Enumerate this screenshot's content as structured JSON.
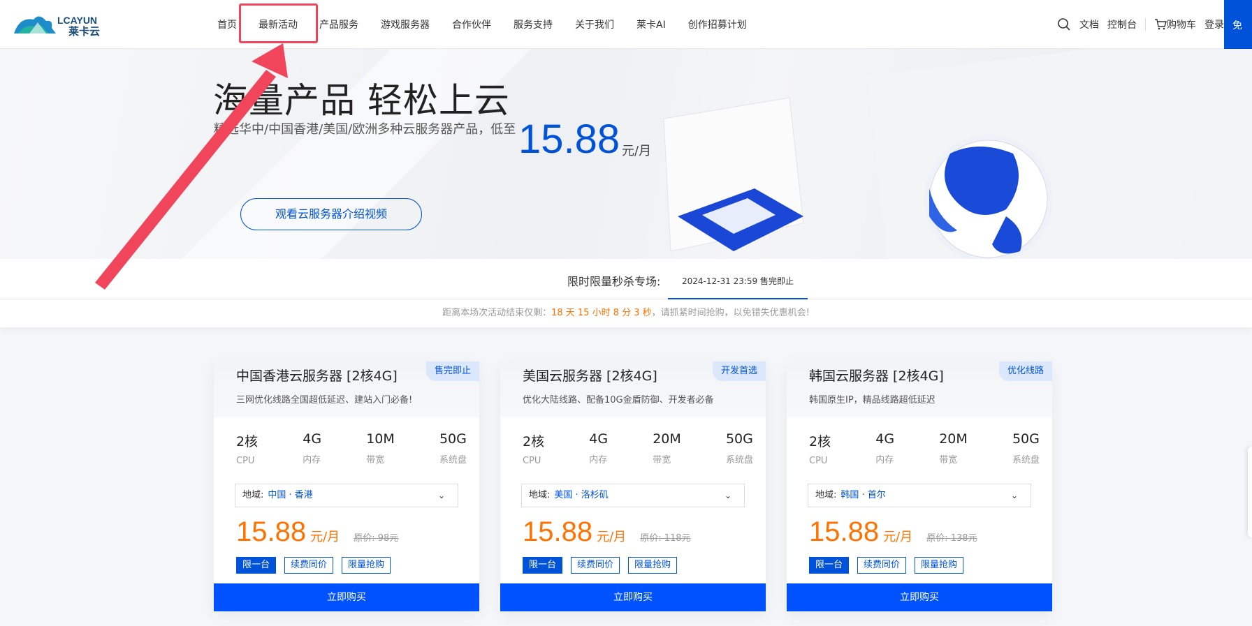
{
  "brand": {
    "logo_text": "LCAYUN",
    "logo_sub": "莱卡云",
    "accent": "#0052d9",
    "price_color": "#ff7200"
  },
  "nav": [
    {
      "label": "首页"
    },
    {
      "label": "最新活动"
    },
    {
      "label": "产品服务"
    },
    {
      "label": "游戏服务器"
    },
    {
      "label": "合作伙伴"
    },
    {
      "label": "服务支持"
    },
    {
      "label": "关于我们"
    },
    {
      "label": "莱卡AI"
    },
    {
      "label": "创作招募计划"
    }
  ],
  "tools": {
    "docs": "文档",
    "console": "控制台",
    "cart": "购物车",
    "login": "登录",
    "free": "免"
  },
  "banner": {
    "title": "海量产品 轻松上云",
    "subtitle": "精选华中/中国香港/美国/欧洲多种云服务器产品，低至",
    "price": "15.88",
    "unit": "元/月",
    "video_button": "观看云服务器介绍视频"
  },
  "flash": {
    "label": "限时限量秒杀专场:",
    "tab": "2024-12-31 23:59 售完即止",
    "countdown_prefix": "距离本场次活动结束仅剩：",
    "countdown": "18 天 15 小时 8 分 3 秒",
    "countdown_suffix": "，请抓紧时间抢购，以免错失优惠机会!"
  },
  "cards": [
    {
      "title": "中国香港云服务器 [2核4G]",
      "tag": "售完即止",
      "desc": "三网优化线路全国超低延迟、建站入门必备!",
      "specs": [
        {
          "v": "2核",
          "l": "CPU"
        },
        {
          "v": "4G",
          "l": "内存"
        },
        {
          "v": "10M",
          "l": "带宽"
        },
        {
          "v": "50G",
          "l": "系统盘"
        }
      ],
      "region_label": "地域:",
      "region": "中国 · 香港",
      "price": "15.88",
      "unit": "元/月",
      "orig": "原价: 98元",
      "tags": [
        "限一台",
        "续费同价",
        "限量抢购"
      ],
      "buy": "立即购买"
    },
    {
      "title": "美国云服务器 [2核4G]",
      "tag": "开发首选",
      "desc": "优化大陆线路、配备10G金盾防御、开发者必备",
      "specs": [
        {
          "v": "2核",
          "l": "CPU"
        },
        {
          "v": "4G",
          "l": "内存"
        },
        {
          "v": "20M",
          "l": "带宽"
        },
        {
          "v": "50G",
          "l": "系统盘"
        }
      ],
      "region_label": "地域:",
      "region": "美国 · 洛杉矶",
      "price": "15.88",
      "unit": "元/月",
      "orig": "原价: 118元",
      "tags": [
        "限一台",
        "续费同价",
        "限量抢购"
      ],
      "buy": "立即购买"
    },
    {
      "title": "韩国云服务器 [2核4G]",
      "tag": "优化线路",
      "desc": "韩国原生IP，精品线路超低延迟",
      "specs": [
        {
          "v": "2核",
          "l": "CPU"
        },
        {
          "v": "4G",
          "l": "内存"
        },
        {
          "v": "20M",
          "l": "带宽"
        },
        {
          "v": "50G",
          "l": "系统盘"
        }
      ],
      "region_label": "地域:",
      "region": "韩国 · 首尔",
      "price": "15.88",
      "unit": "元/月",
      "orig": "原价: 138元",
      "tags": [
        "限一台",
        "续费同价",
        "限量抢购"
      ],
      "buy": "立即购买"
    }
  ]
}
